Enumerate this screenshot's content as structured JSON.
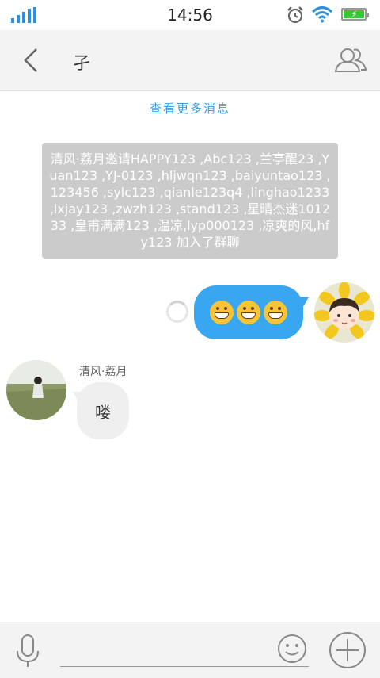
{
  "status": {
    "time": "14:56"
  },
  "header": {
    "title": "孑"
  },
  "chat": {
    "more_link": "查看更多消息",
    "system_message": "清风·荔月邀请HAPPY123 ,Abc123 ,兰亭醒23 ,Yuan123 ,YJ-0123 ,hljwqn123 ,baiyuntao123 ,123456 ,sylc123 ,qianle123q4 ,linghao1233 ,lxjay123 ,zwzh123 ,stand123 ,星晴杰迷101233 ,皇甫满满123 ,温凉,lyp000123 ,凉爽的风,hfy123 加入了群聊",
    "outgoing_emojis": [
      "grin-emoji",
      "grin-emoji",
      "grin-emoji"
    ],
    "incoming": {
      "sender": "清风·荔月",
      "text": "喽"
    }
  },
  "input": {
    "placeholder": ""
  },
  "colors": {
    "accent": "#38a6f0",
    "system_bg": "#cbcbcb",
    "incoming_bg": "#efefef"
  }
}
